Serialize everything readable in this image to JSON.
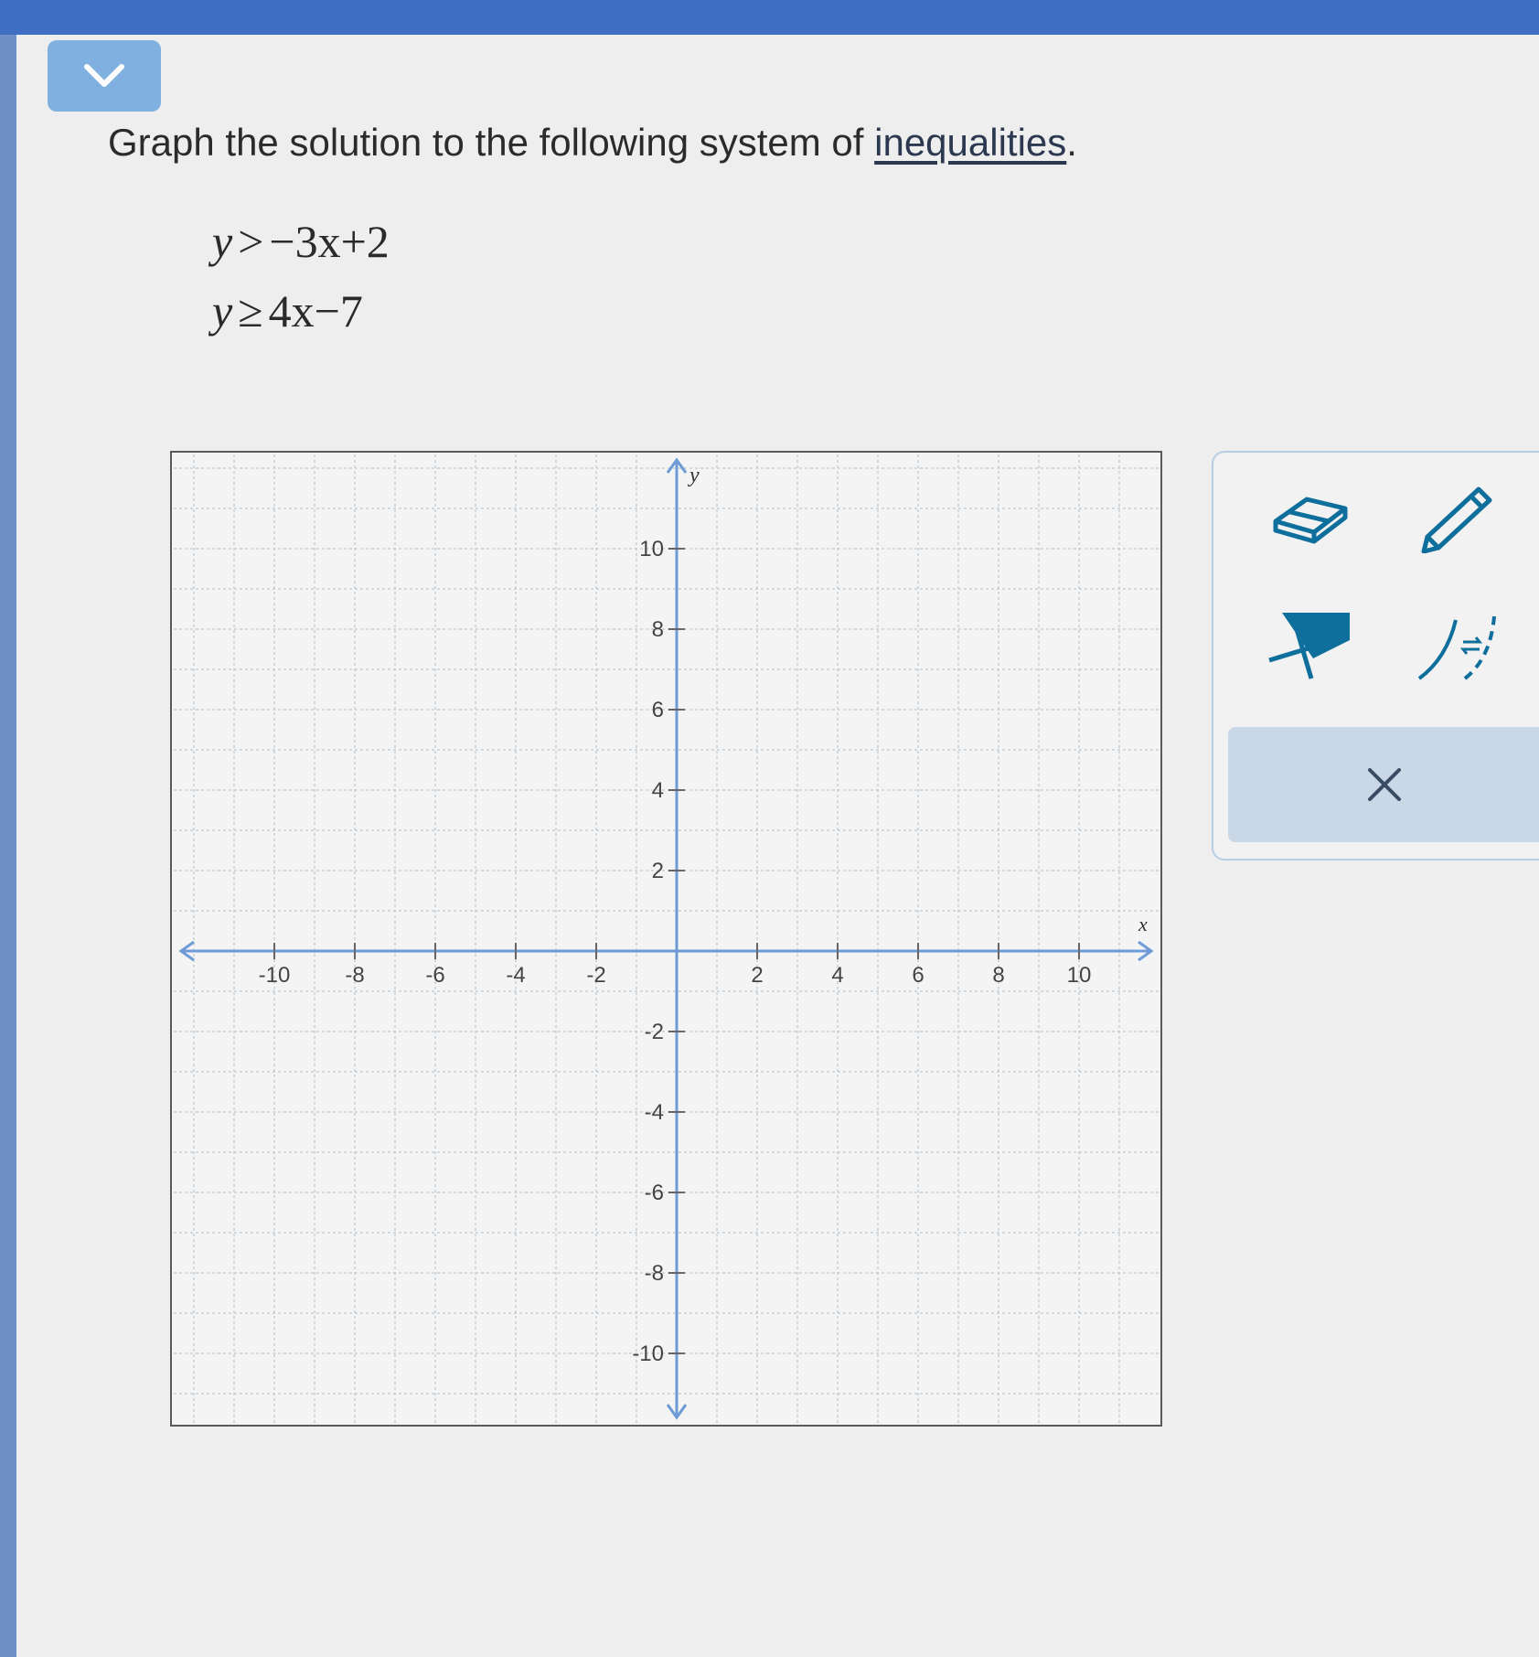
{
  "prompt": {
    "text": "Graph the solution to the following system of ",
    "link": "inequalities",
    "end": "."
  },
  "system": [
    {
      "lhs": "y",
      "op": ">",
      "rhs": "−3x+2"
    },
    {
      "lhs": "y",
      "op": "≥",
      "rhs": "4x−7"
    }
  ],
  "graph": {
    "x_label": "x",
    "y_label": "y",
    "x_ticks": [
      "-10",
      "-8",
      "-6",
      "-4",
      "-2",
      "2",
      "4",
      "6",
      "8",
      "10"
    ],
    "y_ticks": [
      "10",
      "8",
      "6",
      "4",
      "2",
      "-2",
      "-4",
      "-6",
      "-8",
      "-10"
    ],
    "xlim": [
      -12,
      12
    ],
    "ylim": [
      -12,
      12
    ]
  },
  "tools": {
    "eraser": "eraser-icon",
    "pencil": "pencil-icon",
    "region": "shade-region-icon",
    "toggle": "solid-dashed-toggle-icon",
    "clear": "close-icon"
  },
  "colors": {
    "accent": "#3f6fc2",
    "axis": "#6e9bd6",
    "tool_blue": "#0e6e9c",
    "button": "#7fb0e0"
  }
}
